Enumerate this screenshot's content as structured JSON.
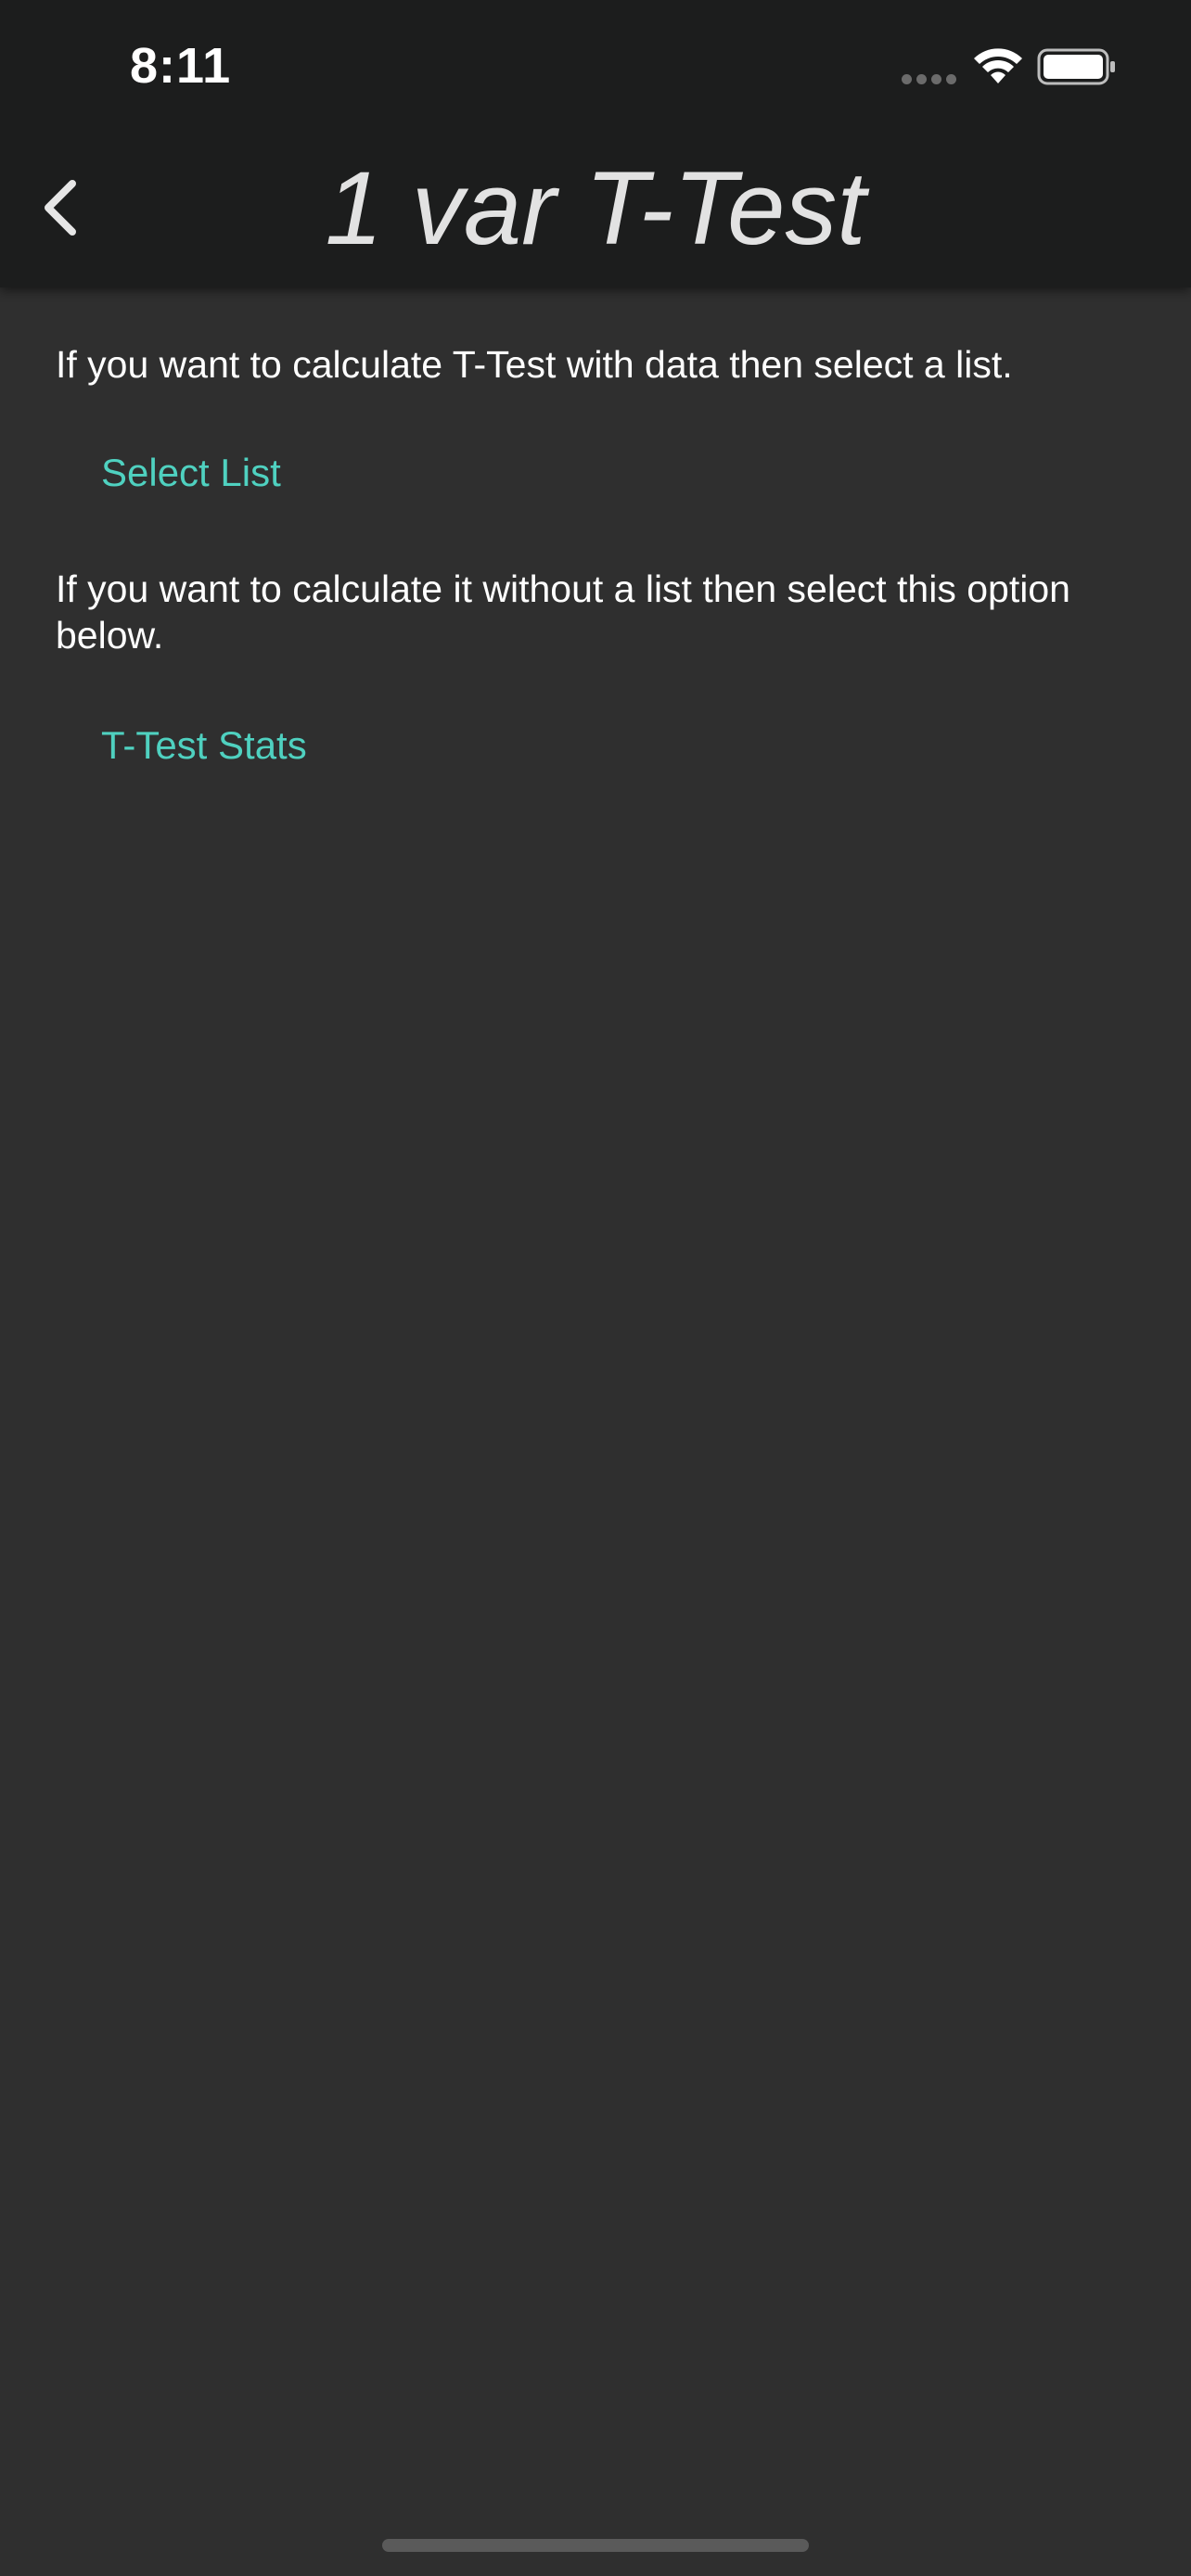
{
  "status_bar": {
    "time": "8:11"
  },
  "nav": {
    "title": "1 var T-Test",
    "back_icon": "chevron-left-icon"
  },
  "content": {
    "intro_text": "If you want to calculate T-Test with data then select a list.",
    "select_list_label": "Select List",
    "alt_text": "If you want to calculate it without a list then select this option below.",
    "ttest_stats_label": "T-Test Stats"
  },
  "colors": {
    "background": "#2f2f2f",
    "nav_background": "#1c1d1d",
    "accent": "#4fd1c0",
    "text": "#ffffff"
  }
}
